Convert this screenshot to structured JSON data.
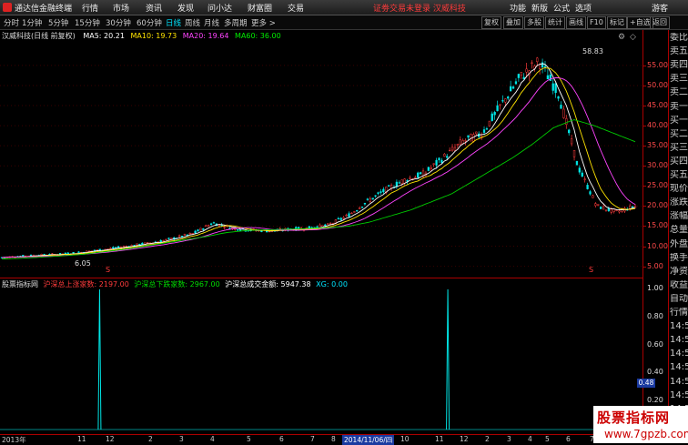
{
  "app": {
    "title": "通达信金融终端",
    "menus": [
      "行情",
      "市场",
      "资讯",
      "发现",
      "问小达",
      "财富圈",
      "交易"
    ],
    "status_text": "证劵交易未登录  汉威科技",
    "right_menus": [
      "功能",
      "新版",
      "公式",
      "选项",
      "游客"
    ]
  },
  "toolbar": {
    "periods": [
      "分时",
      "1分钟",
      "5分钟",
      "15分钟",
      "30分钟",
      "60分钟",
      "日线",
      "周线",
      "月线",
      "多周期",
      "更多 >"
    ],
    "active_period": "日线",
    "buttons": [
      "复权",
      "叠加",
      "多股",
      "统计",
      "画线",
      "F10",
      "标记",
      "+自选",
      "返回"
    ]
  },
  "main_chart": {
    "stock_label": "汉威科技(日线 前复权)",
    "ma_labels": [
      {
        "text": "MA5: 20.21",
        "color": "#ffffff"
      },
      {
        "text": "MA10: 19.73",
        "color": "#ffe400"
      },
      {
        "text": "MA20: 19.64",
        "color": "#ff44ff"
      },
      {
        "text": "MA60: 36.00",
        "color": "#00ee00"
      }
    ],
    "high_label": "58.83",
    "low_label": "6.05",
    "y_ticks": [
      "55.00",
      "50.00",
      "45.00",
      "40.00",
      "35.00",
      "30.00",
      "25.00",
      "20.00",
      "15.00",
      "10.00",
      "5.00"
    ],
    "marker_glyph": "S"
  },
  "indicator": {
    "name": "股票指标网",
    "items": [
      {
        "text": "沪深总上涨家数: 2197.00",
        "color": "#ff3b3b"
      },
      {
        "text": "沪深总下跌家数: 2967.00",
        "color": "#00dd00"
      },
      {
        "text": "沪深总成交金额: 5947.38",
        "color": "#ffffff"
      },
      {
        "text": "XG: 0.00",
        "color": "#00e5ff"
      }
    ],
    "y_ticks": [
      "1.00",
      "0.80",
      "0.60",
      "0.48",
      "0.40",
      "0.20"
    ],
    "current_value": "0.48"
  },
  "dates": {
    "labels": [
      "2013年",
      "11",
      "12",
      "2",
      "3",
      "4",
      "5",
      "6",
      "7",
      "8",
      "9",
      "10",
      "11",
      "12",
      "2",
      "3",
      "4",
      "5",
      "6",
      "7",
      "8"
    ],
    "cursor_date": "2014/11/06/四"
  },
  "right_panel": {
    "rows": [
      "委比",
      "卖五",
      "卖四",
      "卖三",
      "卖二",
      "卖一",
      "买一",
      "买二",
      "买三",
      "买四",
      "买五",
      "现价",
      "涨跌",
      "涨幅",
      "总量",
      "外盘",
      "换手",
      "净资",
      "收益",
      "自动",
      "行情",
      "14:5",
      "14:5",
      "14:5",
      "14:5",
      "14:5",
      "14:5",
      "14:5",
      "14:5",
      "14:5"
    ]
  },
  "watermark": {
    "line1": "股票指标网",
    "line2": "www.7gpzb.com"
  },
  "chart_data": {
    "type": "candlestick",
    "title": "汉威科技(日线 前复权)",
    "ylim": [
      4,
      62
    ],
    "close_trend": [
      7.2,
      7.5,
      7.8,
      8.0,
      8.4,
      9.0,
      9.6,
      10.3,
      11.0,
      12.0,
      13.2,
      15.8,
      14.5,
      14.0,
      13.8,
      14.2,
      14.5,
      15.2,
      17.5,
      21.0,
      24.0,
      26.5,
      28.0,
      32.0,
      36.0,
      38.0,
      45.0,
      52.0,
      56.0,
      48.0,
      30.0,
      20.0,
      18.5,
      20.0
    ],
    "ma60_trend": [
      6.8,
      7.0,
      7.3,
      7.6,
      8.0,
      8.6,
      9.2,
      10.0,
      10.8,
      11.6,
      12.4,
      13.4,
      13.9,
      14.1,
      14.2,
      14.4,
      14.6,
      15.0,
      16.0,
      17.5,
      19.0,
      21.0,
      23.0,
      26.0,
      29.0,
      32.0,
      35.5,
      39.5,
      41.5,
      40.0,
      38.0,
      36.0
    ],
    "xg_signal_positions": [
      0.155,
      0.697
    ],
    "xg_signal_value": 1.0
  }
}
